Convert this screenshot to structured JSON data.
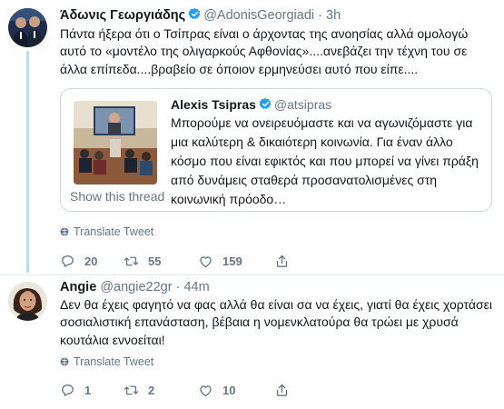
{
  "tweet1": {
    "name": "Άδωνις Γεωργιάδης",
    "handle": "@AdonisGeorgiadi",
    "dot": "·",
    "time": "3h",
    "text": "Πάντα ήξερα ότι ο Τσίπρας είναι ο άρχοντας της ανοησίας αλλά ομολογώ αυτό το «μοντέλο της ολιγαρκούς Αφθονίας»....ανεβάζει την τέχνη του σε άλλα επίπεδα....βραβείο σε όποιον ερμηνεύσει αυτό που είπε....",
    "quote": {
      "name": "Alexis Tsipras",
      "handle": "@atsipras",
      "text": "Μπορούμε να ονειρευόμαστε και να αγωνιζόμαστε για μια καλύτερη & δικαιότερη κοινωνία. Για έναν άλλο κόσμο που είναι εφικτός και που μπορεί να γίνει πράξη από δυνάμεις σταθερά προσανατολισμένες στη κοινωνική πρόοδο…",
      "show_thread": "Show this thread"
    },
    "translate": "Translate Tweet",
    "replies": "20",
    "retweets": "55",
    "likes": "159"
  },
  "tweet2": {
    "name": "Angie",
    "handle": "@angie22gr",
    "dot": "·",
    "time": "44m",
    "text": "Δεν θα έχεις φαγητό να φας αλλά θα είναι σα να έχεις, γιατί θα έχεις χορτάσει σοσιαλιστική επανάσταση, βέβαια η νομενκλατούρα θα τρώει με χρυσά κουτάλια εννοείται!",
    "translate": "Translate Tweet",
    "replies": "1",
    "retweets": "2",
    "likes": "10"
  },
  "colors": {
    "verified": "#1da1f2",
    "thread_line": "#b8dcf2",
    "secondary_text": "#657786",
    "border": "#ccd6dd"
  }
}
